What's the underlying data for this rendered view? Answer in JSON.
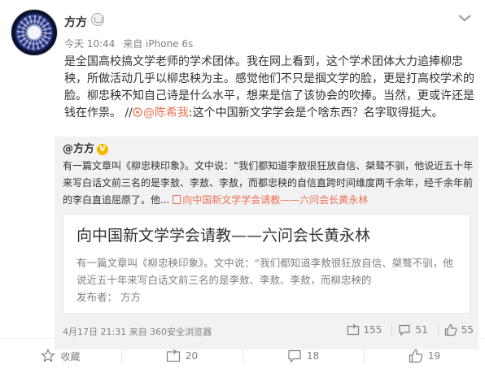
{
  "author": {
    "name": "方方",
    "avatar_icon": "flower-avatar",
    "badge_icon": "vip-crown-icon"
  },
  "meta": {
    "time": "今天 10:44",
    "source": "来自 iPhone 6s"
  },
  "content": {
    "text_main": "是全国高校搞文学老师的学术团体。我在网上看到，这个学术团体大力追捧柳忠秧，所做活动几乎以柳忠秧为主。感觉他们不只是掴文学的脸，更是打高校学术的脸。柳忠秧不知自己诗是什么水平，想来是信了该协会的吹捧。当然，更或许还是钱在作祟。 //",
    "mention": "@陈希我",
    "text_after": ":这个中国新文学学会是个啥东西？名字取得挺大。"
  },
  "repost": {
    "author": "@方方",
    "verified_label": "V",
    "text": "有一篇文章叫《柳忠秧印象》。文中说：“我们都知道李敖很狂放自信、桀骜不驯，他说近五十年来写白话文前三名的是李敖、李敖、李敖，而都忠秧的自信直跨时间维度两千余年，经千余年前的李白直追屈原了。他...",
    "link_text": "向中国新文学学会请教——六问会长黄永林",
    "card": {
      "title": "向中国新文学学会请教——六问会长黄永林",
      "desc": "有一篇文章叫《柳忠秧印象》。文中说：“我们都知道李敖很狂放自信、桀骜不驯，他说近五十年来写白话文前三名的是李敖、李敖、李敖，而柳忠秧的",
      "publisher": "发布者： 方方"
    },
    "foot": "4月17日 21:31 来自 360安全浏览器",
    "stats": {
      "forward": "155",
      "comment": "51",
      "like": "55"
    }
  },
  "actions": {
    "favorite": "收藏",
    "forward": "20",
    "comment": "18",
    "like": "19"
  },
  "colors": {
    "accent": "#eb7350",
    "muted": "#808080",
    "repost_bg": "#f2f2f5"
  }
}
